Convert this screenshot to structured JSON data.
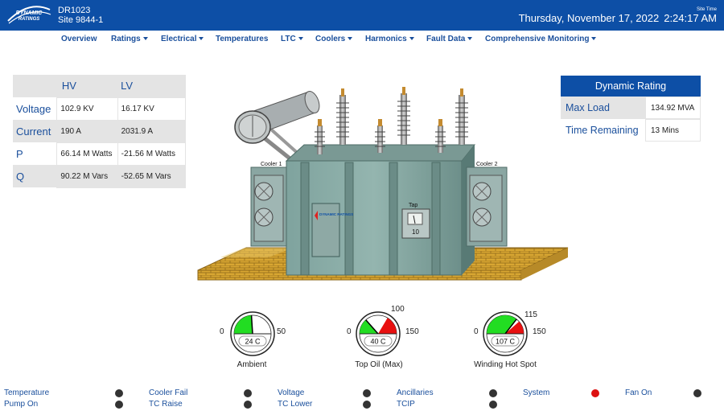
{
  "header": {
    "logo_text": "DYNAMIC RATINGS",
    "device_id": "DR1023",
    "site": "Site 9844-1",
    "site_time_label": "Site Time",
    "date": "Thursday, November 17, 2022",
    "time": "2:24:17 AM"
  },
  "nav": [
    {
      "label": "Overview",
      "dropdown": false
    },
    {
      "label": "Ratings",
      "dropdown": true
    },
    {
      "label": "Electrical",
      "dropdown": true
    },
    {
      "label": "Temperatures",
      "dropdown": false
    },
    {
      "label": "LTC",
      "dropdown": true
    },
    {
      "label": "Coolers",
      "dropdown": true
    },
    {
      "label": "Harmonics",
      "dropdown": true
    },
    {
      "label": "Fault Data",
      "dropdown": true
    },
    {
      "label": "Comprehensive Monitoring",
      "dropdown": true
    }
  ],
  "electrical": {
    "col_hv": "HV",
    "col_lv": "LV",
    "rows": [
      {
        "label": "Voltage",
        "hv": "102.9 KV",
        "lv": "16.17 KV"
      },
      {
        "label": "Current",
        "hv": "190 A",
        "lv": "2031.9 A"
      },
      {
        "label": "P",
        "hv": "66.14 M Watts",
        "lv": "-21.56 M Watts"
      },
      {
        "label": "Q",
        "hv": "90.22 M Vars",
        "lv": "-52.65 M Vars"
      }
    ]
  },
  "dynamic_rating": {
    "title": "Dynamic Rating",
    "max_load_label": "Max Load",
    "max_load_value": "134.92 MVA",
    "time_remaining_label": "Time Remaining",
    "time_remaining_value": "13 Mins"
  },
  "transformer": {
    "cooler1_label": "Cooler 1",
    "cooler2_label": "Cooler 2",
    "tap_label": "Tap",
    "tap_value": "10",
    "cabinet_logo": "DYNAMIC RATINGS"
  },
  "gauges": [
    {
      "name": "Ambient",
      "value": 24,
      "display": "24 C",
      "min": "0",
      "max": "50",
      "alarm": "",
      "fill_fraction": 0.48,
      "alarm_fraction": null
    },
    {
      "name": "Top Oil (Max)",
      "value": 40,
      "display": "40 C",
      "min": "0",
      "max": "150",
      "alarm": "100",
      "fill_fraction": 0.27,
      "alarm_fraction": 0.67
    },
    {
      "name": "Winding Hot Spot",
      "value": 107,
      "display": "107 C",
      "min": "0",
      "max": "150",
      "alarm": "115",
      "fill_fraction": 0.71,
      "alarm_fraction": 0.77
    }
  ],
  "colors": {
    "brand_blue": "#0d4fa6",
    "gauge_green": "#22dd22",
    "gauge_red": "#e81010",
    "led_off": "#333333",
    "led_alarm": "#dd1111"
  },
  "status": [
    {
      "label": "Temperature",
      "state": "off"
    },
    {
      "label": "Cooler Fail",
      "state": "off"
    },
    {
      "label": "Voltage",
      "state": "off"
    },
    {
      "label": "Ancillaries",
      "state": "off"
    },
    {
      "label": "System",
      "state": "alarm"
    },
    {
      "label": "Fan On",
      "state": "off"
    },
    {
      "label": "Pump On",
      "state": "off"
    },
    {
      "label": "TC Raise",
      "state": "off"
    },
    {
      "label": "TC Lower",
      "state": "off"
    },
    {
      "label": "TCIP",
      "state": "off"
    }
  ]
}
